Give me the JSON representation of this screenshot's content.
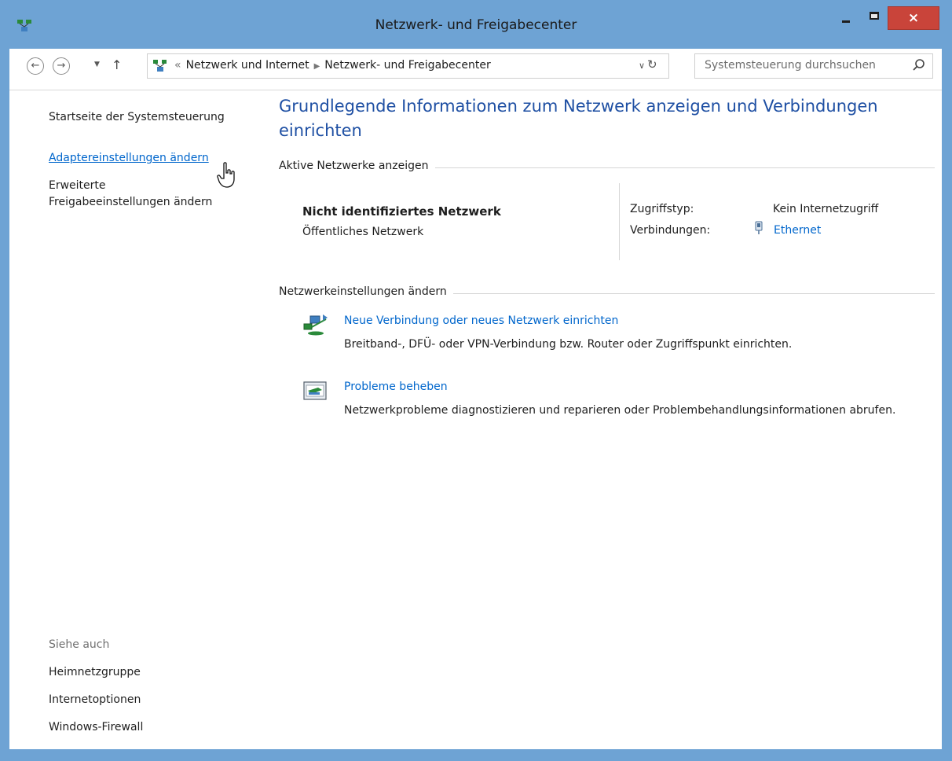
{
  "window": {
    "title": "Netzwerk- und Freigabecenter",
    "close_label": "×",
    "colors": {
      "frame": "#6ea3d4",
      "close": "#c9443a",
      "link": "#0066cc",
      "heading": "#1e4fa3"
    }
  },
  "addressbar": {
    "back_icon": "back-arrow-icon",
    "forward_icon": "forward-arrow-icon",
    "overflow": "«",
    "crumbs": [
      "Netzwerk und Internet",
      "Netzwerk- und Freigabecenter"
    ],
    "search_placeholder": "Systemsteuerung durchsuchen"
  },
  "sidebar": {
    "home": "Startseite der Systemsteuerung",
    "adapter": "Adaptereinstellungen ändern",
    "advanced_line1": "Erweiterte",
    "advanced_line2": "Freigabeeinstellungen ändern",
    "see_also": "Siehe auch",
    "see_also_items": [
      "Heimnetzgruppe",
      "Internetoptionen",
      "Windows-Firewall"
    ]
  },
  "main": {
    "heading": "Grundlegende Informationen zum Netzwerk anzeigen und Verbindungen einrichten",
    "active_section": "Aktive Netzwerke anzeigen",
    "network_name": "Nicht identifiziertes Netzwerk",
    "network_category": "Öffentliches Netzwerk",
    "access_type_label": "Zugriffstyp:",
    "access_type_value": "Kein Internetzugriff",
    "connections_label": "Verbindungen:",
    "connections_value": "Ethernet",
    "change_section": "Netzwerkeinstellungen ändern",
    "tasks": [
      {
        "icon": "new-connection-icon",
        "link": "Neue Verbindung oder neues Netzwerk einrichten",
        "desc": "Breitband-, DFÜ- oder VPN-Verbindung bzw. Router oder Zugriffspunkt einrichten."
      },
      {
        "icon": "troubleshoot-icon",
        "link": "Probleme beheben",
        "desc": "Netzwerkprobleme diagnostizieren und reparieren oder Problembehandlungsinformationen abrufen."
      }
    ]
  }
}
